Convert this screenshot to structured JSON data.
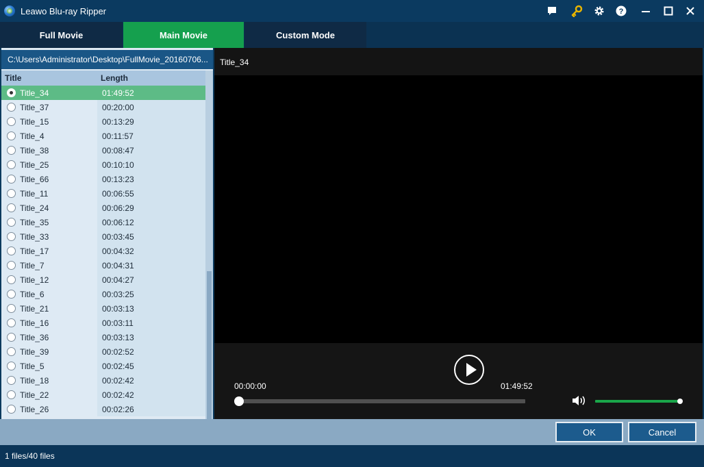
{
  "window": {
    "title": "Leawo Blu-ray Ripper",
    "icons": [
      "app-logo-icon",
      "feedback-icon",
      "key-icon",
      "gear-icon",
      "help-icon",
      "minimize-icon",
      "maximize-icon",
      "close-icon"
    ],
    "key_icon_color": "#e8b400"
  },
  "modes": {
    "full_movie": "Full Movie",
    "main_movie": "Main Movie",
    "custom_mode": "Custom Mode",
    "active": "Main Movie",
    "active_color": "#15a04e"
  },
  "file_list": {
    "path": "C:\\Users\\Administrator\\Desktop\\FullMovie_20160706...",
    "columns": {
      "title": "Title",
      "length": "Length"
    },
    "selected_index": 0,
    "rows": [
      {
        "title": "Title_34",
        "length": "01:49:52"
      },
      {
        "title": "Title_37",
        "length": "00:20:00"
      },
      {
        "title": "Title_15",
        "length": "00:13:29"
      },
      {
        "title": "Title_4",
        "length": "00:11:57"
      },
      {
        "title": "Title_38",
        "length": "00:08:47"
      },
      {
        "title": "Title_25",
        "length": "00:10:10"
      },
      {
        "title": "Title_66",
        "length": "00:13:23"
      },
      {
        "title": "Title_11",
        "length": "00:06:55"
      },
      {
        "title": "Title_24",
        "length": "00:06:29"
      },
      {
        "title": "Title_35",
        "length": "00:06:12"
      },
      {
        "title": "Title_33",
        "length": "00:03:45"
      },
      {
        "title": "Title_17",
        "length": "00:04:32"
      },
      {
        "title": "Title_7",
        "length": "00:04:31"
      },
      {
        "title": "Title_12",
        "length": "00:04:27"
      },
      {
        "title": "Title_6",
        "length": "00:03:25"
      },
      {
        "title": "Title_21",
        "length": "00:03:13"
      },
      {
        "title": "Title_16",
        "length": "00:03:11"
      },
      {
        "title": "Title_36",
        "length": "00:03:13"
      },
      {
        "title": "Title_39",
        "length": "00:02:52"
      },
      {
        "title": "Title_5",
        "length": "00:02:45"
      },
      {
        "title": "Title_18",
        "length": "00:02:42"
      },
      {
        "title": "Title_22",
        "length": "00:02:42"
      },
      {
        "title": "Title_26",
        "length": "00:02:26"
      }
    ]
  },
  "player": {
    "title": "Title_34",
    "current_time": "00:00:00",
    "duration": "01:49:52",
    "progress": 0,
    "volume": 1.0,
    "icons": [
      "play-icon",
      "volume-icon"
    ]
  },
  "buttons": {
    "ok": "OK",
    "cancel": "Cancel"
  },
  "status": {
    "text": "1 files/40 files"
  }
}
